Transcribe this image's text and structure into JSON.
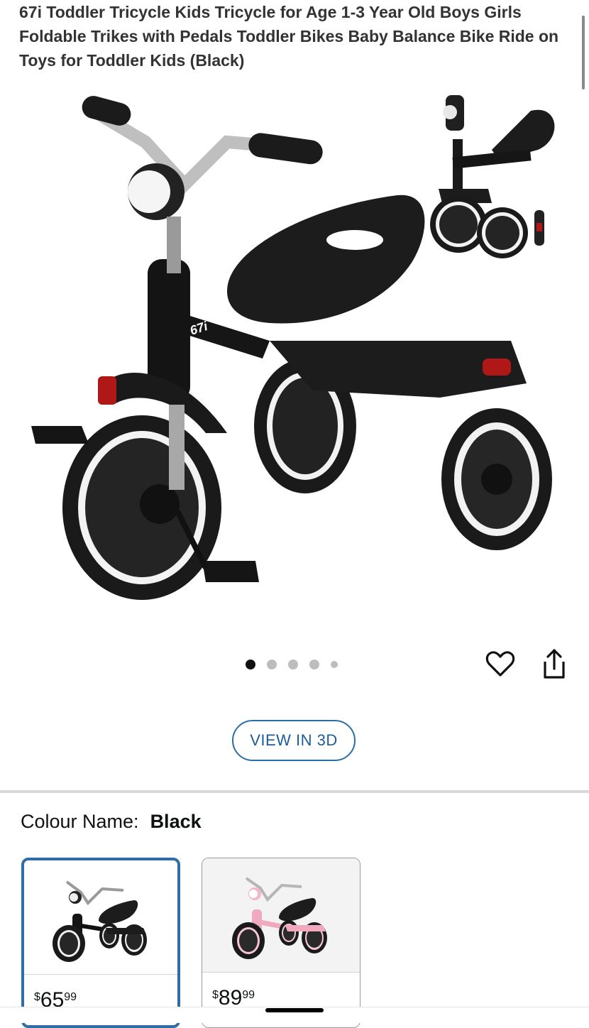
{
  "product": {
    "title": "67i Toddler Tricycle Kids Tricycle for Age 1-3 Year Old Boys Girls Foldable Trikes with Pedals Toddler Bikes Baby Balance Bike Ride on Toys for Toddler Kids (Black)"
  },
  "gallery": {
    "image_count": 5,
    "active_index": 0,
    "favorite_icon": "heart-icon",
    "share_icon": "share-icon"
  },
  "view3d": {
    "label": "VIEW IN 3D"
  },
  "colour": {
    "label": "Colour Name:",
    "selected": "Black"
  },
  "swatches": [
    {
      "name": "Black",
      "price_symbol": "$",
      "price_whole": "65",
      "price_fraction": "99",
      "selected": true
    },
    {
      "name": "Pink",
      "price_symbol": "$",
      "price_whole": "89",
      "price_fraction": "99",
      "selected": false
    }
  ],
  "colors": {
    "accent_blue": "#2f6ea5",
    "link_blue": "#1e5c97",
    "divider": "#d9d9d9"
  }
}
